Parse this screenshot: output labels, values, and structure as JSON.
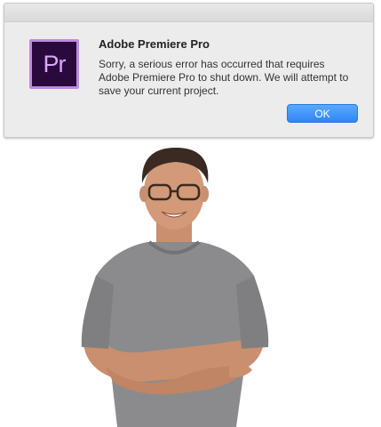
{
  "dialog": {
    "title": "Adobe Premiere Pro",
    "message": "Sorry, a serious error has occurred that requires Adobe Premiere Pro to shut down. We will attempt to save your current project.",
    "ok_label": "OK",
    "icon_text": "Pr",
    "icon": "premiere-pro-icon"
  },
  "colors": {
    "button": "#2f86f6",
    "icon_bg": "#2a0a3c",
    "icon_border": "#c08ae0"
  }
}
